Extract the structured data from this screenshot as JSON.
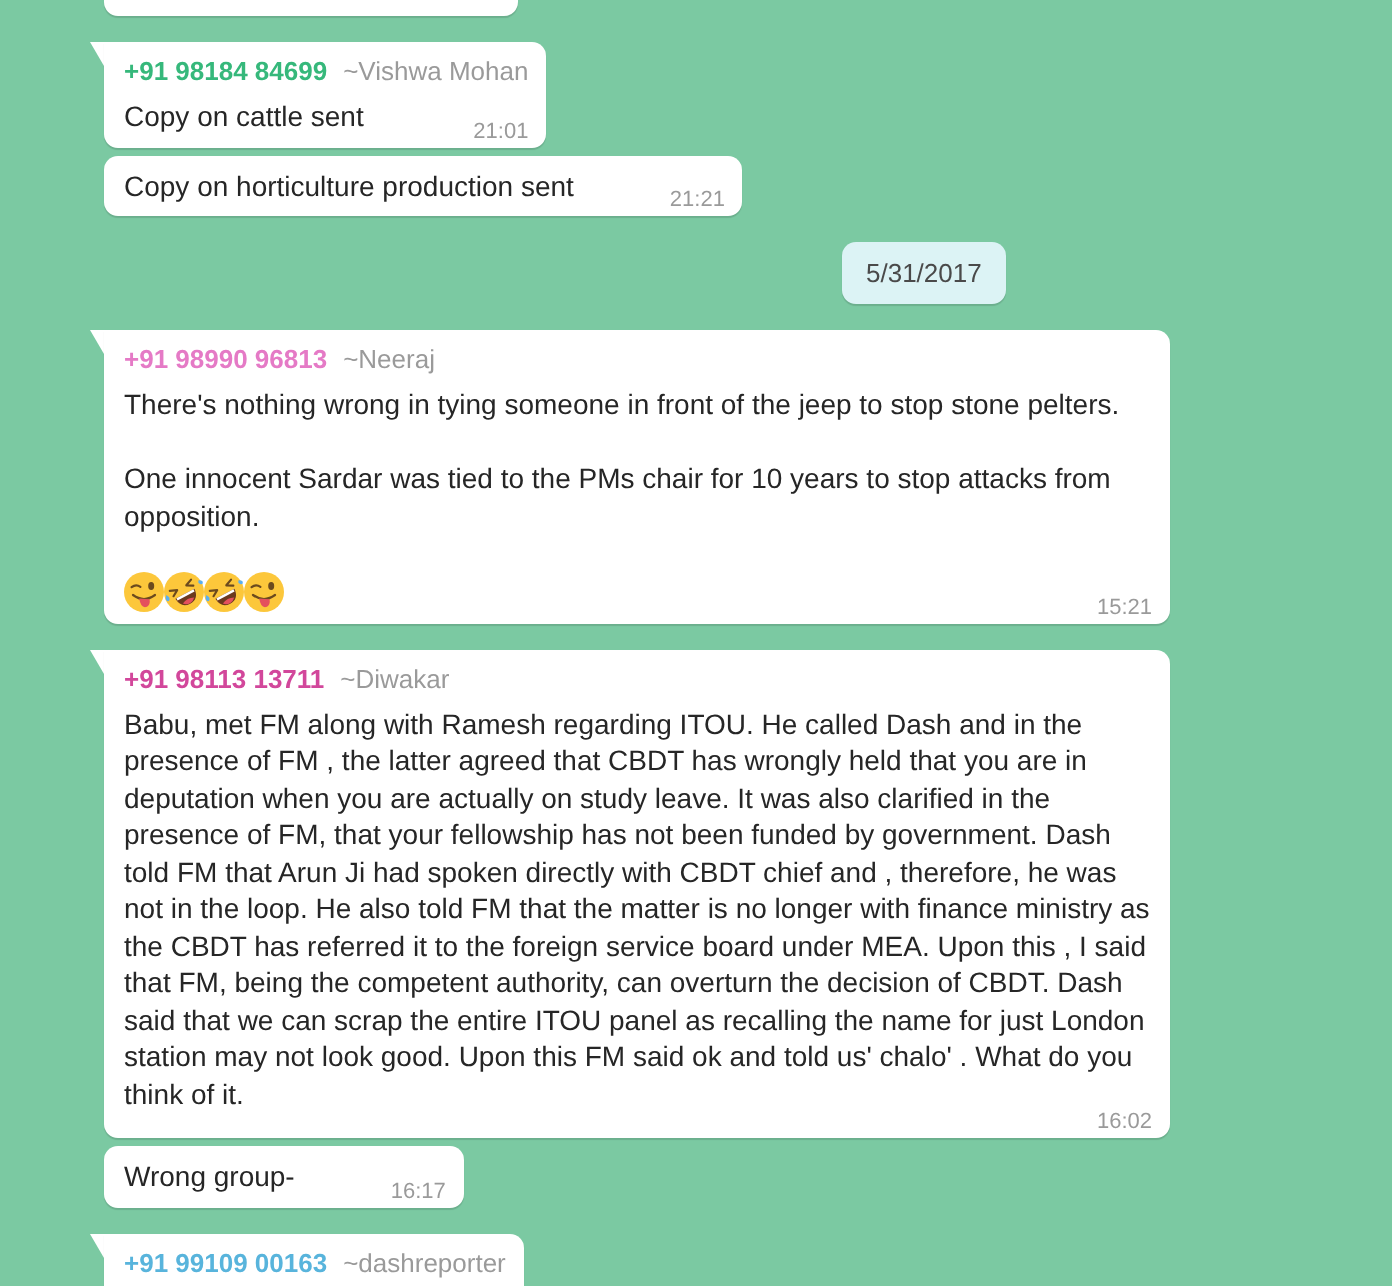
{
  "messages": [
    {
      "kind": "clipped"
    },
    {
      "kind": "message",
      "tail": true,
      "sender": {
        "phone": "+91 98184 84699",
        "name": "~Vishwa Mohan",
        "color": "#36b87b"
      },
      "paragraphs": [
        "Copy on cattle sent"
      ],
      "time": "21:01"
    },
    {
      "kind": "message",
      "tail": false,
      "paragraphs": [
        "Copy on horticulture production sent"
      ],
      "time": "21:21"
    },
    {
      "kind": "date",
      "text": "5/31/2017"
    },
    {
      "kind": "message",
      "tail": true,
      "sender": {
        "phone": "+91 98990 96813",
        "name": "~Neeraj",
        "color": "#e57ac6"
      },
      "paragraphs": [
        "There's nothing wrong in tying someone in front of the jeep to stop stone pelters.",
        "One innocent Sardar was tied to the PMs chair for 10 years to stop attacks from opposition."
      ],
      "emojis": [
        {
          "kind": "wink-tongue"
        },
        {
          "kind": "rolling-laughing"
        },
        {
          "kind": "rolling-laughing"
        },
        {
          "kind": "wink-tongue"
        }
      ],
      "time": "15:21"
    },
    {
      "kind": "message",
      "tail": true,
      "sender": {
        "phone": "+91 98113 13711",
        "name": "~Diwakar",
        "color": "#d2479b"
      },
      "paragraphs": [
        "Babu, met FM along with Ramesh regarding ITOU. He called Dash and in the presence of FM , the latter agreed that CBDT has wrongly held that you are in deputation when you are actually on study leave. It was also clarified in the presence of FM, that your fellowship has not been funded by government. Dash told FM that Arun Ji had spoken directly with CBDT chief and , therefore, he was not in the loop. He also told FM that the matter is no longer with finance ministry as the CBDT has referred it to the foreign service board under MEA. Upon this , I said that FM, being the competent authority, can overturn the decision of CBDT. Dash said that we can scrap the entire ITOU panel as recalling the name for just London station may not look good. Upon this FM said ok and told us' chalo' . What do you think of it."
      ],
      "time": "16:02"
    },
    {
      "kind": "message",
      "tail": false,
      "paragraphs": [
        "Wrong group-"
      ],
      "time": "16:17"
    },
    {
      "kind": "message",
      "tail": true,
      "sender": {
        "phone": "+91 99109 00163",
        "name": "~dashreporter",
        "color": "#58b4dc"
      }
    }
  ]
}
